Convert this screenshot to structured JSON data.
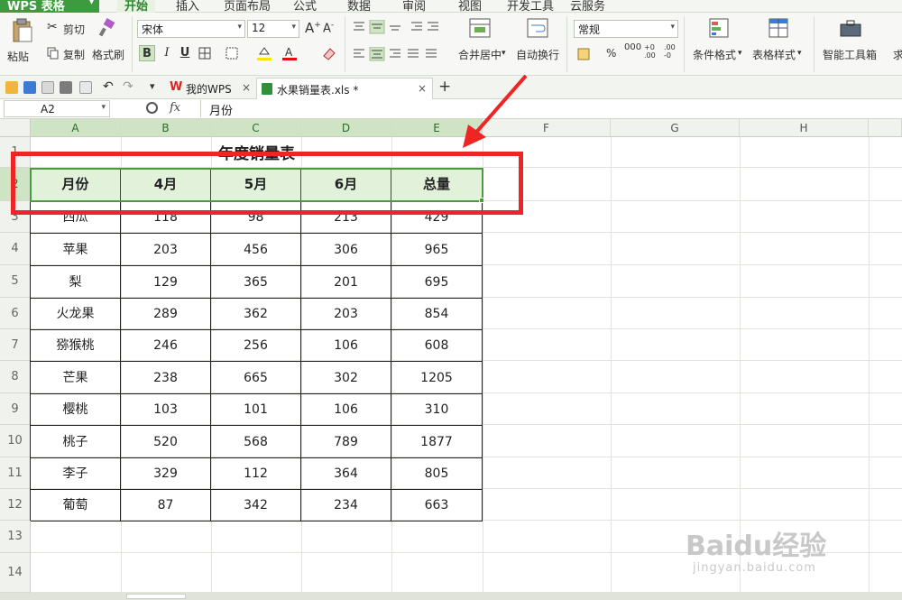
{
  "app": {
    "name": "WPS 表格"
  },
  "menu_tabs": [
    "开始",
    "插入",
    "页面布局",
    "公式",
    "数据",
    "审阅",
    "视图",
    "开发工具",
    "云服务"
  ],
  "ribbon": {
    "paste": "粘贴",
    "cut": "剪切",
    "copy": "复制",
    "format_painter": "格式刷",
    "font_name": "宋体",
    "font_size": "12",
    "bold": "B",
    "italic": "I",
    "underline": "U",
    "merge_center": "合并居中",
    "wrap_text": "自动换行",
    "number_format": "常规",
    "percent": "%",
    "conditional_format": "条件格式",
    "table_style": "表格样式",
    "smart_toolbox": "智能工具箱",
    "more_cut": "求"
  },
  "doc_tabs": [
    {
      "label": "我的WPS",
      "close": "×"
    },
    {
      "label": "水果销量表.xls *",
      "close": "×"
    }
  ],
  "new_tab": "+",
  "formula_bar": {
    "cell_ref": "A2",
    "fx": "fx",
    "content": "月份"
  },
  "columns": [
    "A",
    "B",
    "C",
    "D",
    "E",
    "F",
    "G",
    "H"
  ],
  "rows": [
    "1",
    "2",
    "3",
    "4",
    "5",
    "6",
    "7",
    "8",
    "9",
    "10",
    "11",
    "12",
    "13",
    "14"
  ],
  "sheet": {
    "title": "年度销量表",
    "headers": [
      "月份",
      "4月",
      "5月",
      "6月",
      "总量"
    ],
    "data": [
      [
        "西瓜",
        "118",
        "98",
        "213",
        "429"
      ],
      [
        "苹果",
        "203",
        "456",
        "306",
        "965"
      ],
      [
        "梨",
        "129",
        "365",
        "201",
        "695"
      ],
      [
        "火龙果",
        "289",
        "362",
        "203",
        "854"
      ],
      [
        "猕猴桃",
        "246",
        "256",
        "106",
        "608"
      ],
      [
        "芒果",
        "238",
        "665",
        "302",
        "1205"
      ],
      [
        "樱桃",
        "103",
        "101",
        "106",
        "310"
      ],
      [
        "桃子",
        "520",
        "568",
        "789",
        "1877"
      ],
      [
        "李子",
        "329",
        "112",
        "364",
        "805"
      ],
      [
        "葡萄",
        "87",
        "342",
        "234",
        "663"
      ]
    ]
  },
  "watermark": {
    "main": "Baidu经验",
    "sub": "jingyan.baidu.com"
  },
  "colors": {
    "accent": "#3e9a3e",
    "selection": "#4c9a3f",
    "annotation": "#ee2525",
    "header_fill": "#e2f1da"
  }
}
